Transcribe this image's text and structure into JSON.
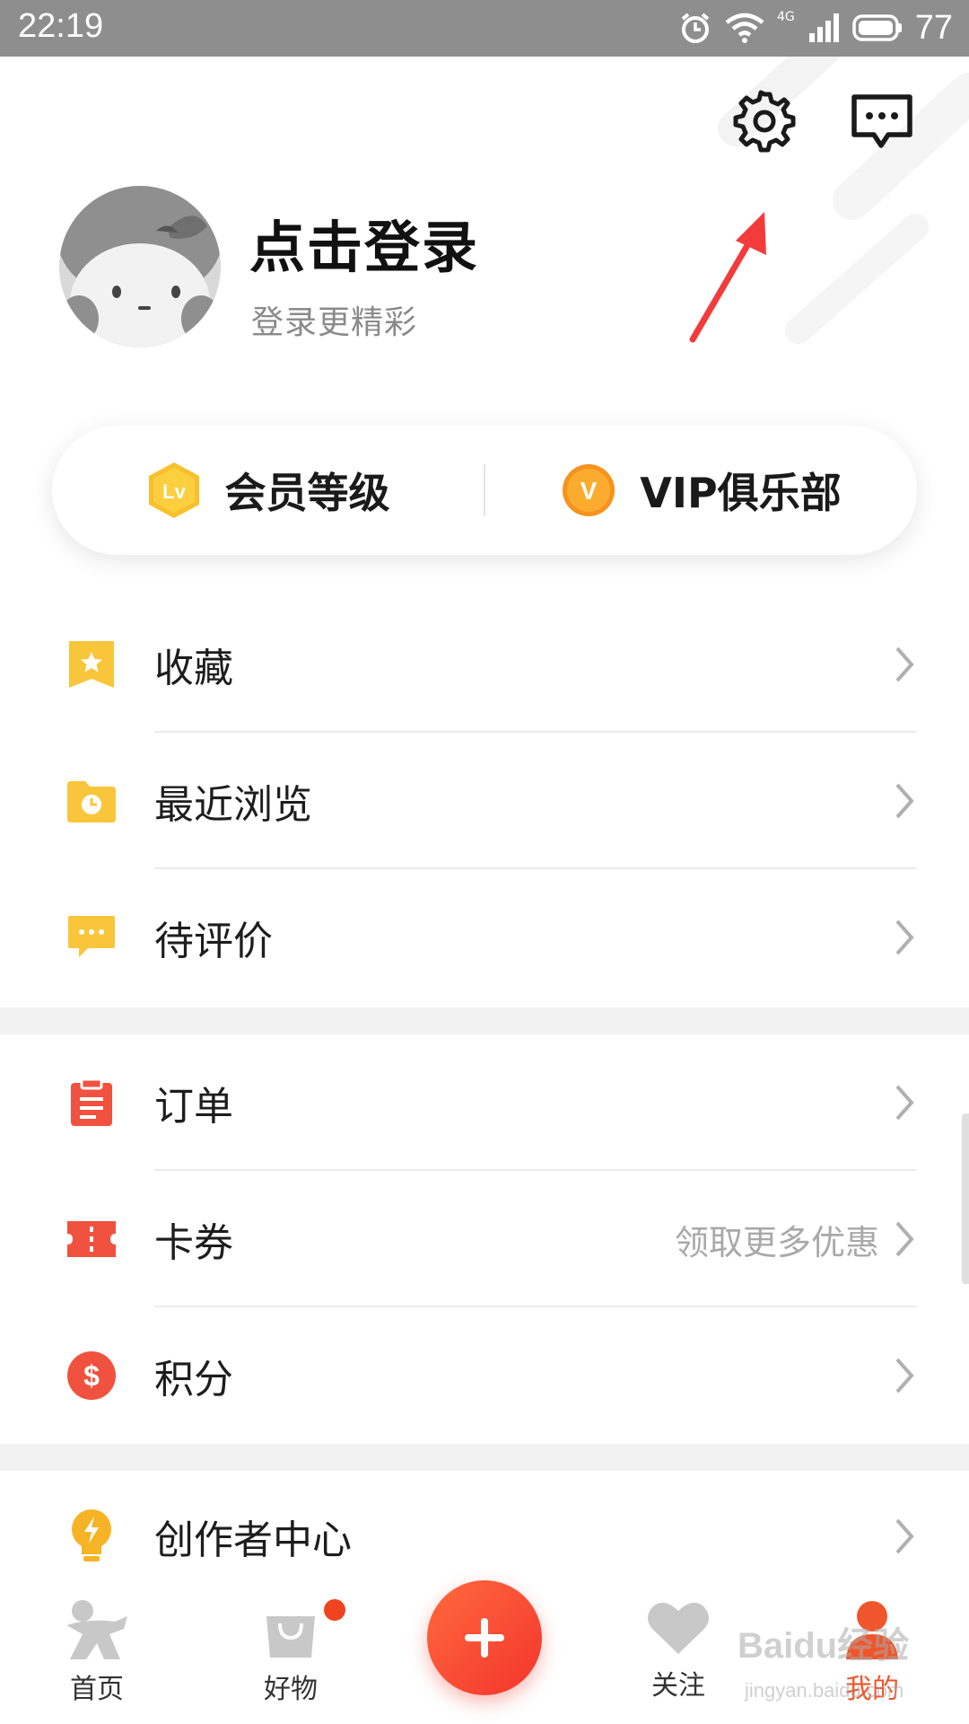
{
  "status_bar": {
    "time": "22:19",
    "network": "4G",
    "battery": "77"
  },
  "header": {
    "login_title": "点击登录",
    "login_subtitle": "登录更精彩"
  },
  "member": {
    "level_label": "会员等级",
    "level_icon_text": "Lv",
    "vip_label": "VIP俱乐部",
    "vip_icon_text": "V"
  },
  "list1": [
    {
      "label": "收藏",
      "icon": "star-bookmark-icon",
      "color": "#f9c53a"
    },
    {
      "label": "最近浏览",
      "icon": "clock-folder-icon",
      "color": "#f9c53a"
    },
    {
      "label": "待评价",
      "icon": "chat-bubble-icon",
      "color": "#f9c53a"
    }
  ],
  "list2": [
    {
      "label": "订单",
      "icon": "clipboard-icon",
      "color": "#f0523f"
    },
    {
      "label": "卡券",
      "icon": "ticket-icon",
      "color": "#f0523f",
      "hint": "领取更多优惠"
    },
    {
      "label": "积分",
      "icon": "coin-icon",
      "color": "#f0523f"
    }
  ],
  "list3": [
    {
      "label": "创作者中心",
      "icon": "lightbulb-icon",
      "color": "#f7b326"
    }
  ],
  "bottom_nav": {
    "home": "首页",
    "goods": "好物",
    "follow": "关注",
    "mine": "我的"
  },
  "watermark": {
    "text": "Baidu经验",
    "url": "jingyan.baidu.com"
  },
  "colors": {
    "accent": "#f0552b",
    "yellow": "#f9c53a",
    "red": "#f0523f"
  }
}
